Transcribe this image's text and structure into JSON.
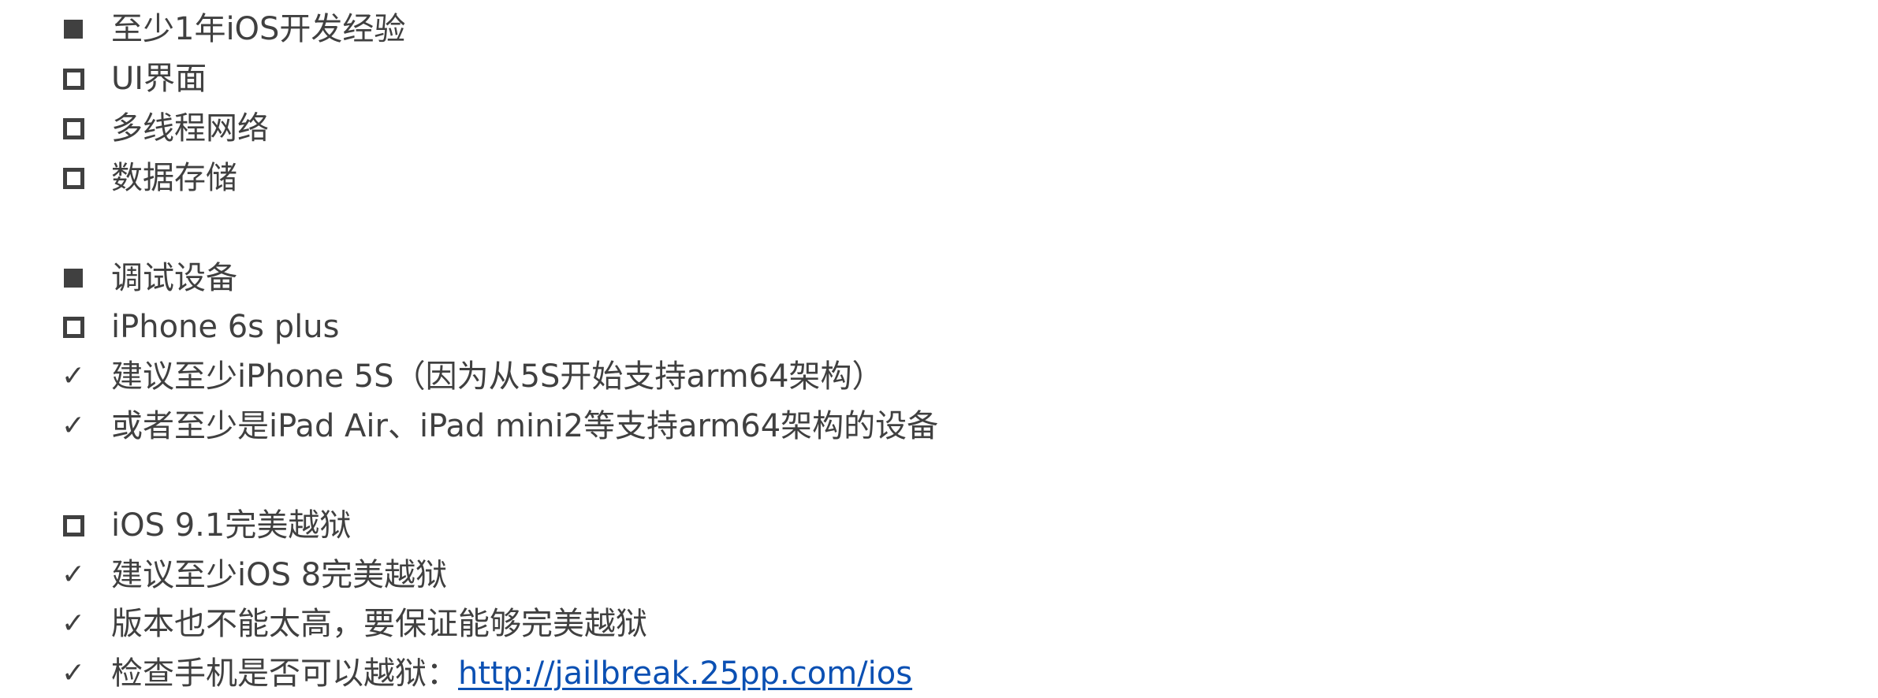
{
  "sections": [
    {
      "items": [
        {
          "bullet": "filled-square",
          "text": "至少1年iOS开发经验"
        },
        {
          "bullet": "hollow-square",
          "text": "UI界面"
        },
        {
          "bullet": "hollow-square",
          "text": "多线程网络"
        },
        {
          "bullet": "hollow-square",
          "text": "数据存储"
        }
      ]
    },
    {
      "items": [
        {
          "bullet": "filled-square",
          "text": "调试设备"
        },
        {
          "bullet": "hollow-square",
          "text": "iPhone 6s plus"
        },
        {
          "bullet": "check",
          "text": "建议至少iPhone 5S（因为从5S开始支持arm64架构）"
        },
        {
          "bullet": "check",
          "text": "或者至少是iPad Air、iPad mini2等支持arm64架构的设备"
        }
      ]
    },
    {
      "items": [
        {
          "bullet": "hollow-square",
          "text": "iOS 9.1完美越狱"
        },
        {
          "bullet": "check",
          "text": "建议至少iOS 8完美越狱"
        },
        {
          "bullet": "check",
          "text": "版本也不能太高，要保证能够完美越狱"
        },
        {
          "bullet": "check",
          "text": "检查手机是否可以越狱：",
          "link": "http://jailbreak.25pp.com/ios"
        }
      ]
    }
  ],
  "check_glyph": "✓",
  "colors": {
    "text": "#404040",
    "link": "#0b50b3",
    "background": "#ffffff"
  }
}
